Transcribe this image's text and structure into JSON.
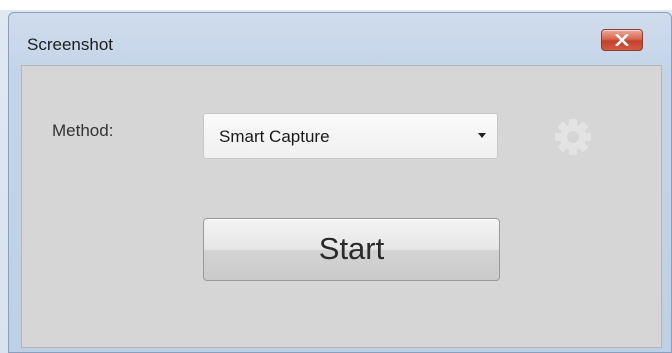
{
  "window": {
    "title": "Screenshot",
    "close_icon": "close-x-icon"
  },
  "form": {
    "method_label": "Method:",
    "method_value": "Smart Capture",
    "dropdown_icon": "chevron-down-icon",
    "settings_icon": "gear-icon"
  },
  "actions": {
    "start_label": "Start"
  },
  "colors": {
    "close_button": "#c4402a",
    "client_background": "#d6d6d6",
    "titlebar": "#c4d4e8"
  }
}
